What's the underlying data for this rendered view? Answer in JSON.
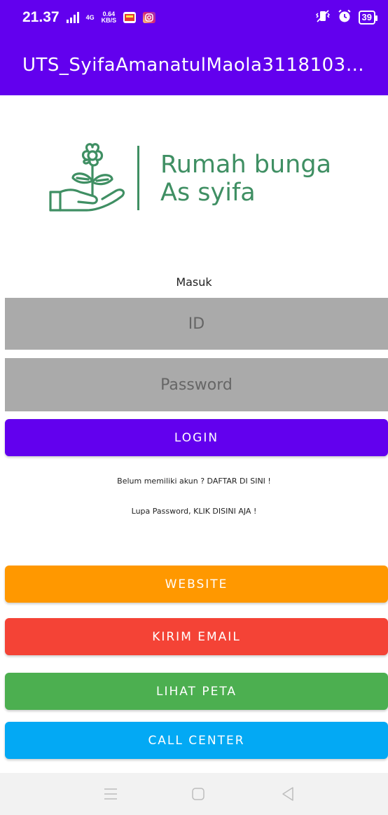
{
  "status_bar": {
    "time": "21.37",
    "network_type": "4G",
    "net_speed_value": "0.64",
    "net_speed_unit": "KB/S",
    "battery": "39",
    "icons": [
      "signal-icon",
      "signal-4g-icon",
      "app-notification-icon",
      "instagram-icon",
      "vibrate-icon",
      "alarm-icon",
      "battery-icon"
    ]
  },
  "app_bar": {
    "title": "UTS_SyifaAmanatulMaola3118103…"
  },
  "logo": {
    "line1": "Rumah bunga",
    "line2": "As syifa"
  },
  "form": {
    "heading": "Masuk",
    "id_placeholder": "ID",
    "password_placeholder": "Password",
    "login_label": "LOGIN",
    "register_text": "Belum memiliki akun ? DAFTAR DI SINI !",
    "forgot_text": "Lupa Password, KLIK DISINI AJA !"
  },
  "actions": {
    "website_label": "WEBSITE",
    "email_label": "KIRIM EMAIL",
    "map_label": "LIHAT PETA",
    "call_label": "CALL CENTER"
  },
  "colors": {
    "primary": "#6200ee",
    "website": "#ff9800",
    "email": "#f44336",
    "map": "#4caf50",
    "call": "#03a9f4",
    "logo_green": "#3f8f63",
    "field_gray": "#aaaaaa"
  },
  "nav_bar": {
    "icons": [
      "menu-icon",
      "home-icon",
      "back-icon"
    ]
  }
}
